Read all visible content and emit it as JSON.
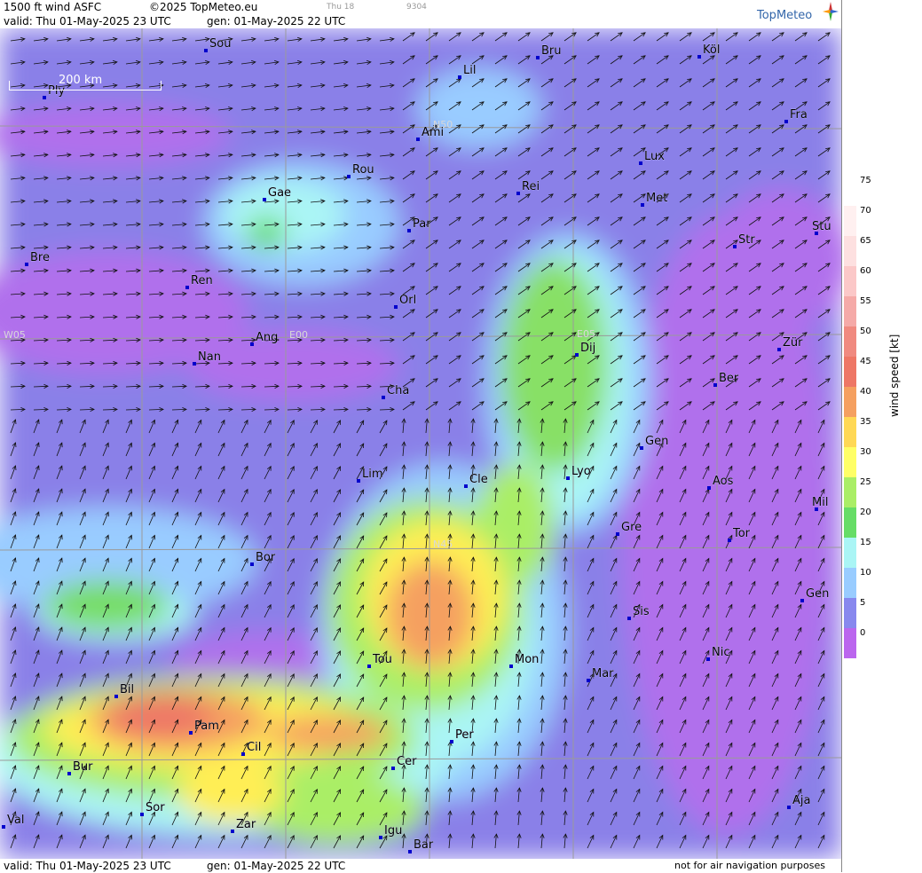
{
  "header": {
    "product": "1500 ft wind ASFC",
    "copyright": "©2025 TopMeteo.eu",
    "day_mark": "Thu 18",
    "code": "9304",
    "valid": "valid:  Thu  01-May-2025  23 UTC",
    "gen": "gen: 01-May-2025 22 UTC",
    "logo": "TopMeteo"
  },
  "footer": {
    "valid": "valid:  Thu  01-May-2025  23 UTC",
    "gen": "gen: 01-May-2025 22 UTC",
    "note": "not for air navigation purposes"
  },
  "scale_bar": {
    "label": "200 km"
  },
  "legend": {
    "title": "wind speed [kt]",
    "ticks": [
      "75",
      "70",
      "65",
      "60",
      "55",
      "50",
      "45",
      "40",
      "35",
      "30",
      "25",
      "20",
      "15",
      "10",
      "5",
      "0"
    ],
    "colors": [
      "#ffffff",
      "#fff0f0",
      "#fde0e0",
      "#fbc8c8",
      "#f5aaa8",
      "#f08a80",
      "#ee7766",
      "#f5a060",
      "#ffd855",
      "#ffff66",
      "#aaee66",
      "#66dd66",
      "#aaf5f5",
      "#99ccff",
      "#8888ee",
      "#bb66ee"
    ]
  },
  "grid_labels": [
    "N50",
    "E05",
    "E00",
    "W05",
    "N45"
  ],
  "cities": [
    "Sou",
    "Bru",
    "Köl",
    "Ply",
    "Lil",
    "Ami",
    "Fra",
    "Rou",
    "Lux",
    "Gae",
    "Rei",
    "Met",
    "Par",
    "Bre",
    "Str",
    "Stu",
    "Ren",
    "Orl",
    "Ang",
    "Dij",
    "Zür",
    "Nan",
    "Ber",
    "Cha",
    "Gen",
    "Lim",
    "Cle",
    "Lyo",
    "Aos",
    "Mil",
    "Gre",
    "Tor",
    "Bor",
    "Gen",
    "Sis",
    "Tou",
    "Mon",
    "Nic",
    "Mar",
    "Bil",
    "Pam",
    "Cil",
    "Per",
    "Cer",
    "Bur",
    "Sor",
    "Ajа",
    "Val",
    "Zar",
    "Igu",
    "Bar"
  ]
}
